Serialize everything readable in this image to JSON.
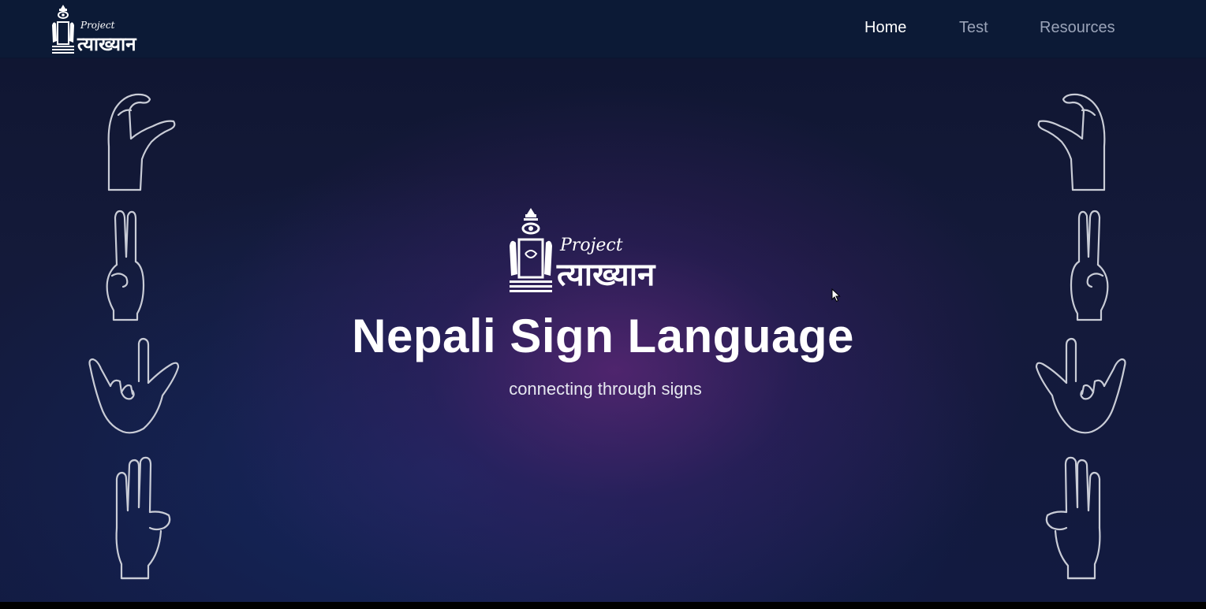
{
  "brand": {
    "project_label": "Project",
    "name_devanagari": "त्याख्यान",
    "emblem_icon": "hand-eye-temple-emblem-icon"
  },
  "nav": {
    "items": [
      {
        "label": "Home",
        "active": true
      },
      {
        "label": "Test",
        "active": false
      },
      {
        "label": "Resources",
        "active": false
      }
    ]
  },
  "hero": {
    "title": "Nepali Sign Language",
    "subtitle": "connecting through signs"
  },
  "decorations": {
    "hand_icons": [
      "c-shape-hand-icon",
      "two-fingers-hand-icon",
      "rock-sign-hand-icon",
      "three-fingers-hand-icon"
    ]
  },
  "colors": {
    "navbar": "#0c1a36",
    "accent_purple": "#62267a",
    "text_primary": "#ffffff",
    "text_muted": "#9aa3b8"
  }
}
